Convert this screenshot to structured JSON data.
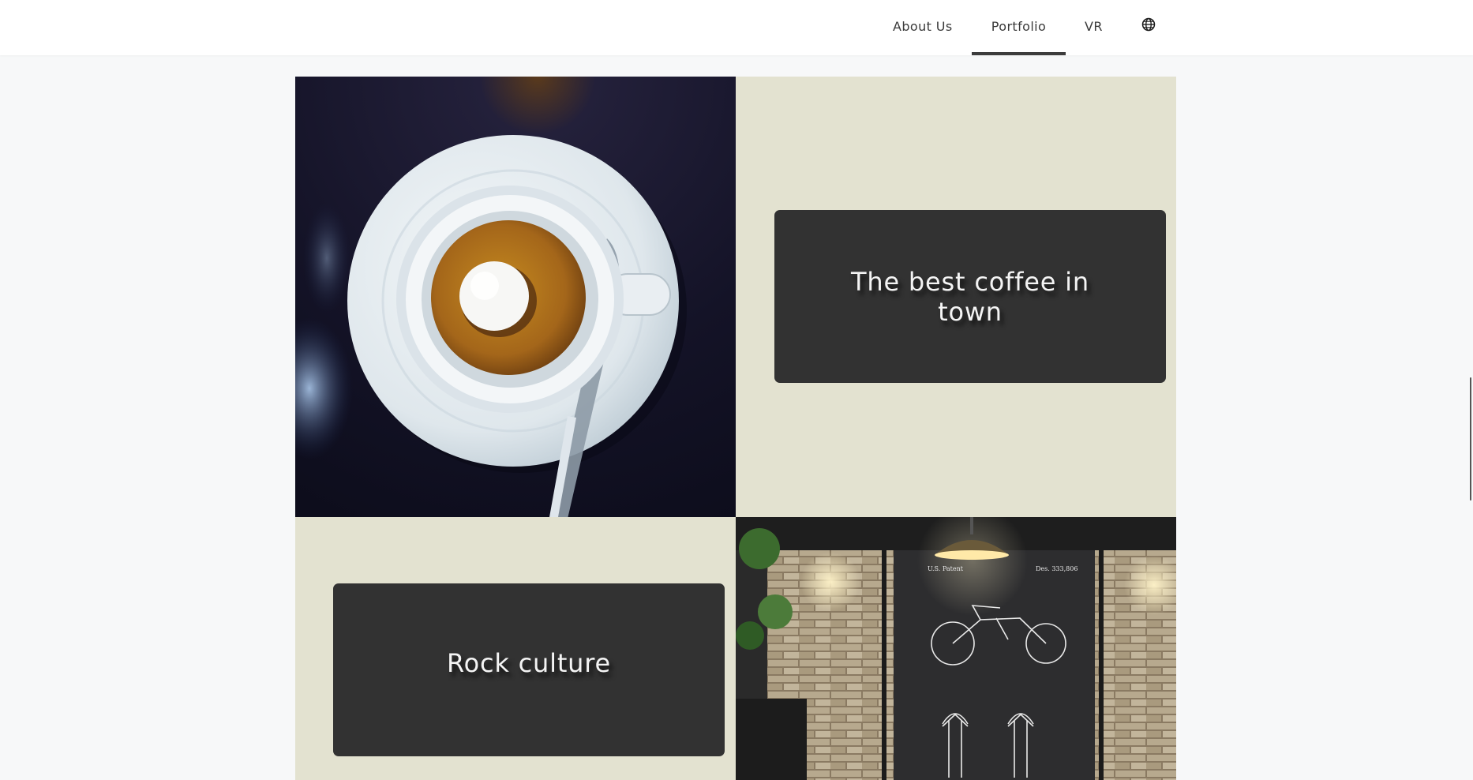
{
  "nav": {
    "items": [
      {
        "label": "About Us"
      },
      {
        "label": "Portfolio",
        "active": true
      },
      {
        "label": "VR"
      }
    ],
    "language_icon": "globe-icon"
  },
  "portfolio": {
    "tiles": [
      {
        "type": "image",
        "image_icon": "espresso-cup-photo"
      },
      {
        "type": "text",
        "title": "The best coffee in town"
      },
      {
        "type": "text",
        "title": "Rock culture"
      },
      {
        "type": "image",
        "image_icon": "motorcycle-blueprint-wall-photo"
      }
    ]
  },
  "colors": {
    "tile_background": "#e3e2d0",
    "card_background": "#323232",
    "page_background": "#f7f8f9"
  }
}
